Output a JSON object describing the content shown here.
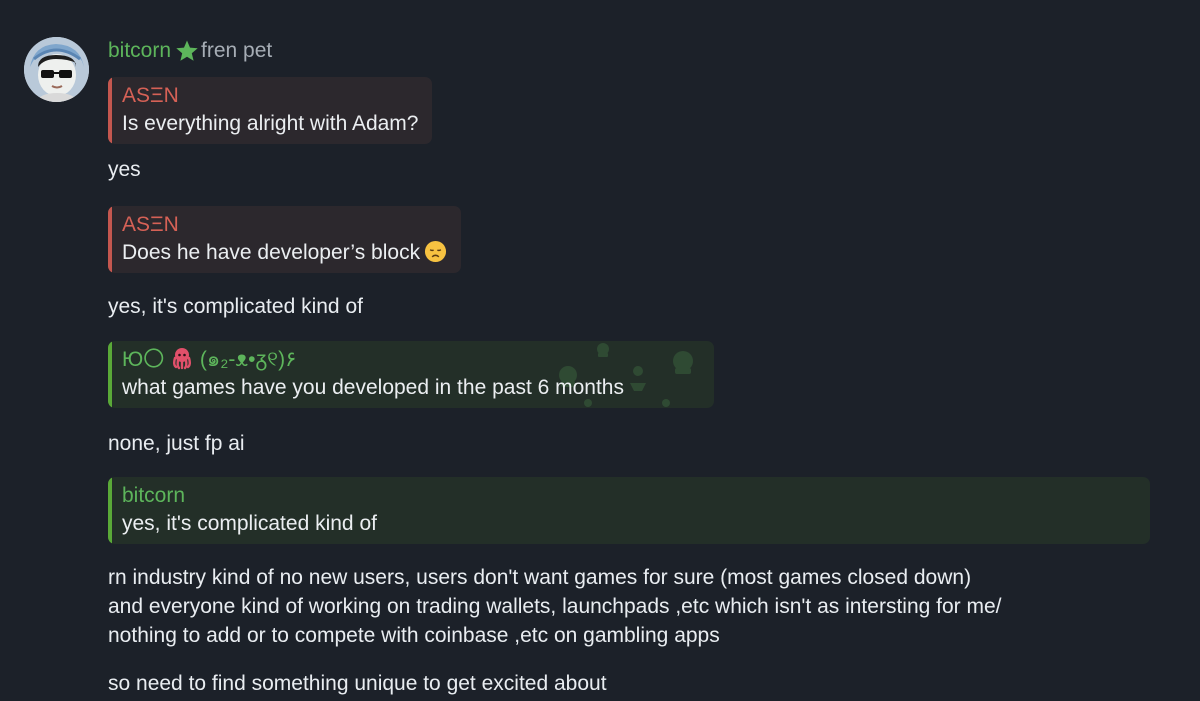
{
  "author": {
    "name": "bitcorn",
    "rank": "fren pet",
    "name_color": "#5db55b",
    "badge_icon": "star-icon"
  },
  "replies": [
    {
      "author": "ASΞN",
      "text": "Is everything alright with Adam?"
    },
    {
      "author": "ASΞN",
      "text": "Does he have developer’s block"
    },
    {
      "author": "Ю〇 ",
      "author_suffix": " (๑₂-ᴥ•ᵹ୧)۶",
      "text": "what games have you developed in the past 6 months"
    },
    {
      "author": "bitcorn",
      "text": "yes, it's complicated kind of"
    }
  ],
  "messages": [
    "yes",
    "yes, it's complicated kind of",
    "none, just fp ai",
    "rn industry kind of no new users, users don't want games for sure (most games closed down)",
    "and everyone kind of working on trading wallets, launchpads ,etc which isn't as intersting for me/",
    "nothing to add or to compete with coinbase ,etc on gambling apps",
    "so need to find something unique to get excited about"
  ],
  "colors": {
    "background": "#1c2129",
    "red_accent": "#c4574f",
    "green_accent": "#5aa938"
  }
}
